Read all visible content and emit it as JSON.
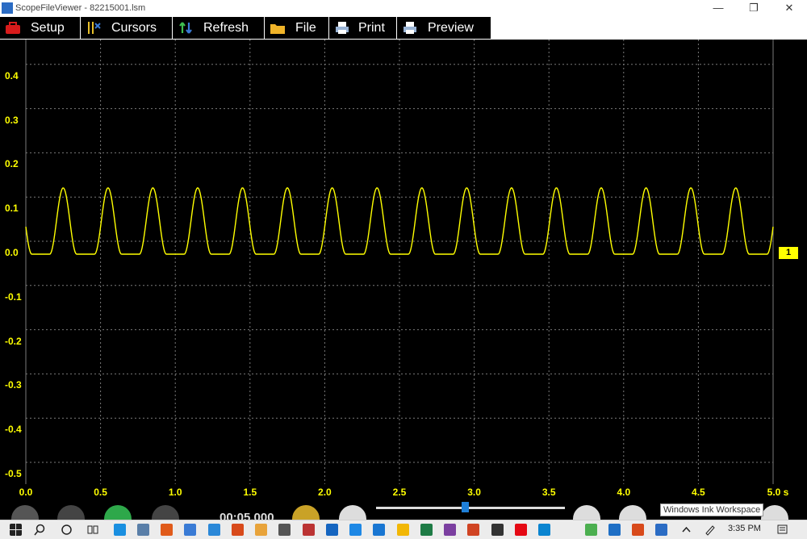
{
  "window": {
    "title": "ScopeFileViewer - 82215001.lsm",
    "controls": {
      "minimize": "—",
      "restore": "❐",
      "close": "✕"
    }
  },
  "toolbar": {
    "setup": "Setup",
    "cursors": "Cursors",
    "refresh": "Refresh",
    "file": "File",
    "print": "Print",
    "preview": "Preview"
  },
  "scope": {
    "y_ticks": [
      "0.4",
      "0.3",
      "0.2",
      "0.1",
      "0.0",
      "-0.1",
      "-0.2",
      "-0.3",
      "-0.4",
      "-0.5"
    ],
    "x_ticks": [
      "0.0",
      "0.5",
      "1.0",
      "1.5",
      "2.0",
      "2.5",
      "3.0",
      "3.5",
      "4.0",
      "4.5",
      "5.0 s"
    ],
    "channel_marker": "1",
    "trace_color": "#ffff00",
    "signal": {
      "baseline": 0.0,
      "peak": 0.15,
      "period_s": 0.3,
      "first_peak_s": 0.25,
      "duration_s": 5.0
    }
  },
  "playback": {
    "timecode": "00:05.000",
    "slider_position": 0.47
  },
  "taskbar": {
    "tooltip": "Windows Ink Workspace",
    "time": "3:35 PM"
  },
  "colors": {
    "trace": "#ffff00",
    "grid": "#7a7a7a",
    "background": "#000000",
    "slider_thumb": "#1e7fd8"
  }
}
